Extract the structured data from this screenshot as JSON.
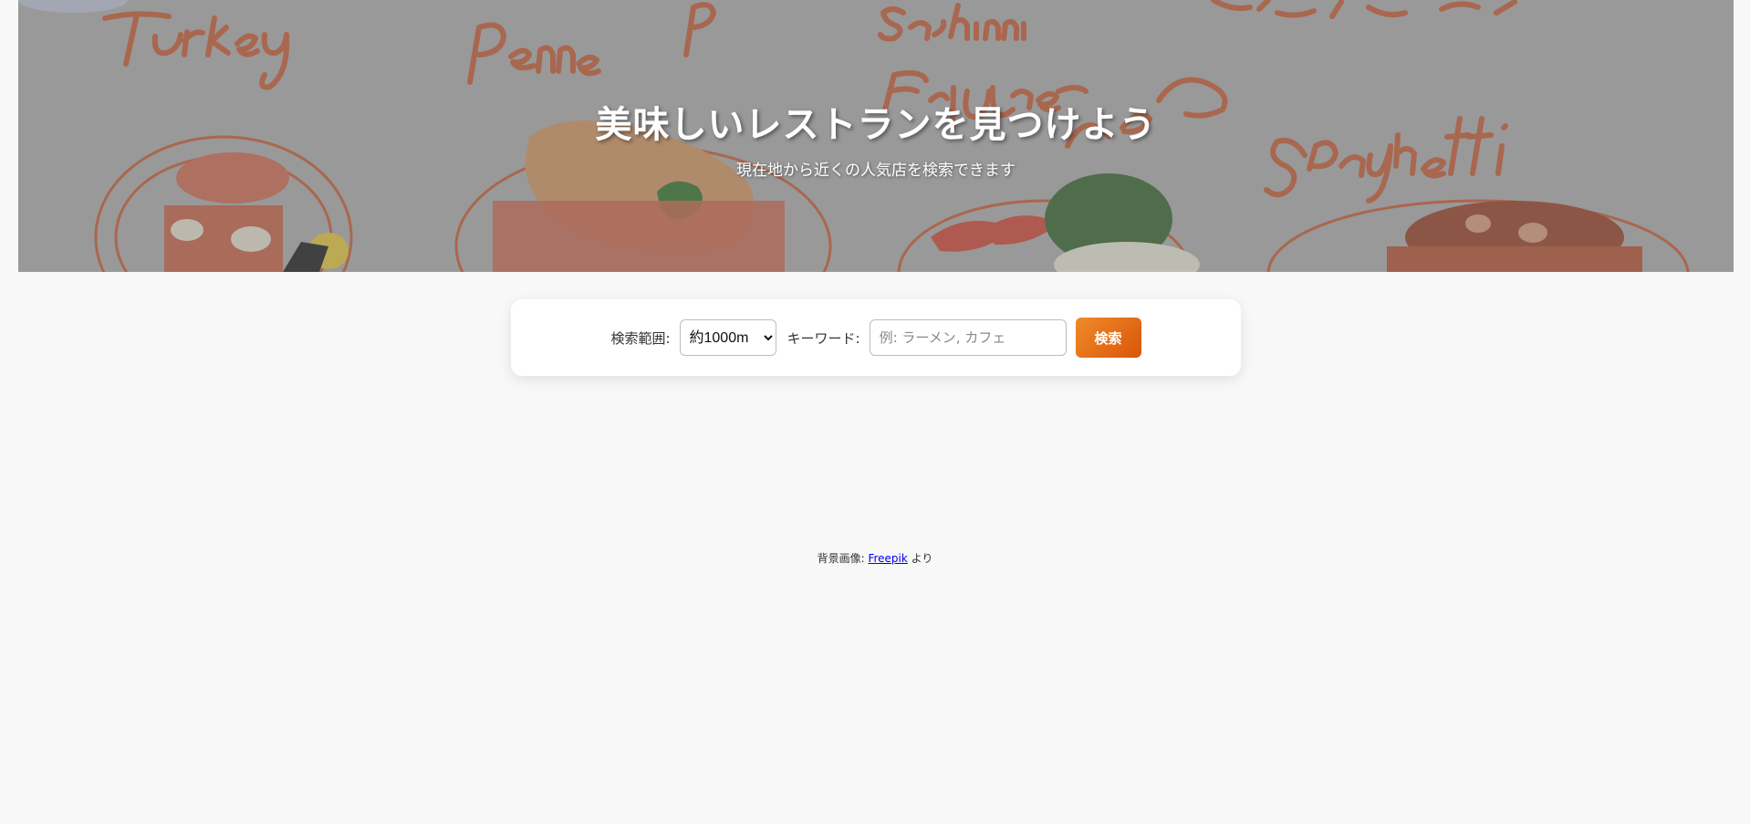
{
  "hero": {
    "title": "美味しいレストランを見つけよう",
    "subtitle": "現在地から近くの人気店を検索できます"
  },
  "search": {
    "range_label": "検索範囲:",
    "range_selected": "約1000m",
    "keyword_label": "キーワード:",
    "keyword_placeholder": "例: ラーメン, カフェ",
    "submit_label": "検索"
  },
  "footer": {
    "credit_prefix": "背景画像:",
    "credit_link": "Freepik",
    "credit_suffix": "より"
  },
  "colors": {
    "accent": "#e8731a",
    "page_background": "#f8f8f8",
    "food_illustration": "#b8532e"
  },
  "icons": [
    "food-illustration-background"
  ]
}
